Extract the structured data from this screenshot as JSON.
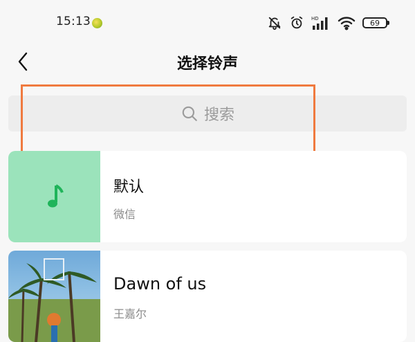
{
  "status_bar": {
    "time": "15:13",
    "battery_level": "69",
    "icons": [
      "notifications-muted-icon",
      "alarm-clock-icon",
      "hd-signal-icon",
      "wifi-icon",
      "battery-icon"
    ]
  },
  "header": {
    "title": "选择铃声",
    "back_icon": "chevron-left-icon"
  },
  "search": {
    "placeholder": "搜索",
    "icon": "search-icon"
  },
  "ringtones": [
    {
      "title": "默认",
      "subtitle": "微信",
      "thumbnail_icon": "music-note-icon",
      "thumbnail_color": "#9be3bb"
    },
    {
      "title": "Dawn of us",
      "subtitle": "王嘉尔",
      "thumbnail_icon": "album-cover-palm-trees"
    }
  ],
  "colors": {
    "highlight_box": "#f07a3f",
    "music_icon": "#1fb45a"
  }
}
